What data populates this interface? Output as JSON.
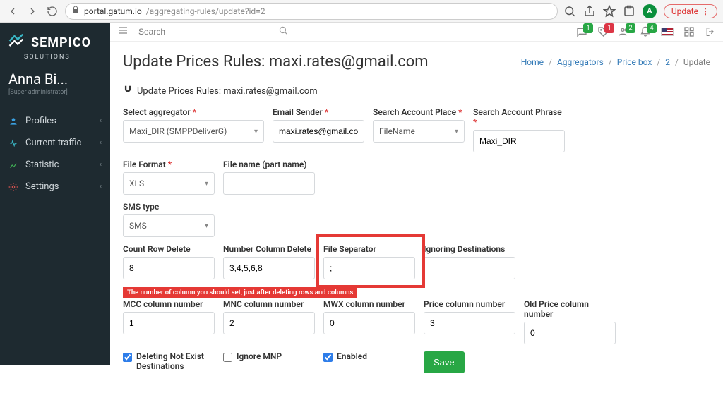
{
  "browser": {
    "url_host": "portal.gatum.io",
    "url_path": "/aggregating-rules/update?id=2",
    "avatar_letter": "A",
    "update_label": "Update"
  },
  "sidebar": {
    "brand": "SEMPICO",
    "brand_sub": "SOLUTIONS",
    "user_name": "Anna Bi...",
    "user_role": "[Super administrator]",
    "items": [
      {
        "label": "Profiles"
      },
      {
        "label": "Current traffic"
      },
      {
        "label": "Statistic"
      },
      {
        "label": "Settings"
      }
    ]
  },
  "topbar": {
    "search_placeholder": "Search",
    "badge1": "1",
    "badge2": "1",
    "badge3": "2",
    "badge4": "4"
  },
  "page": {
    "title": "Update Prices Rules: maxi.rates@gmail.com",
    "sub_title": "Update Prices Rules: maxi.rates@gmail.com"
  },
  "breadcrumb": {
    "home": "Home",
    "aggregators": "Aggregators",
    "pricebox": "Price box",
    "id": "2",
    "current": "Update"
  },
  "form": {
    "select_aggregator_label": "Select aggregator",
    "select_aggregator_value": "Maxi_DIR (SMPPDeliverG)",
    "email_sender_label": "Email Sender",
    "email_sender_value": "maxi.rates@gmail.com",
    "search_account_place_label": "Search Account Place",
    "search_account_place_value": "FileName",
    "search_account_phrase_label": "Search Account Phrase",
    "search_account_phrase_value": "Maxi_DIR",
    "file_format_label": "File Format",
    "file_format_value": "XLS",
    "file_name_label": "File name (part name)",
    "file_name_value": "",
    "sms_type_label": "SMS type",
    "sms_type_value": "SMS",
    "count_row_delete_label": "Count Row Delete",
    "count_row_delete_value": "8",
    "number_col_delete_label": "Number Column Delete",
    "number_col_delete_value": "3,4,5,6,8",
    "file_separator_label": "File Separator",
    "file_separator_value": ";",
    "ignoring_dest_label": "Ignoring Destinations",
    "ignoring_dest_value": "",
    "note_text": "The number of column you should set, just after deleting rows and columns",
    "mcc_label": "MCC column number",
    "mcc_value": "1",
    "mnc_label": "MNC column number",
    "mnc_value": "2",
    "mwx_label": "MWX column number",
    "mwx_value": "0",
    "price_label": "Price column number",
    "price_value": "3",
    "old_price_label": "Old Price column number",
    "old_price_value": "0",
    "deleting_not_exist_label": "Deleting Not Exist Destinations",
    "ignore_mnp_label": "Ignore MNP",
    "enabled_label": "Enabled",
    "save_label": "Save"
  }
}
